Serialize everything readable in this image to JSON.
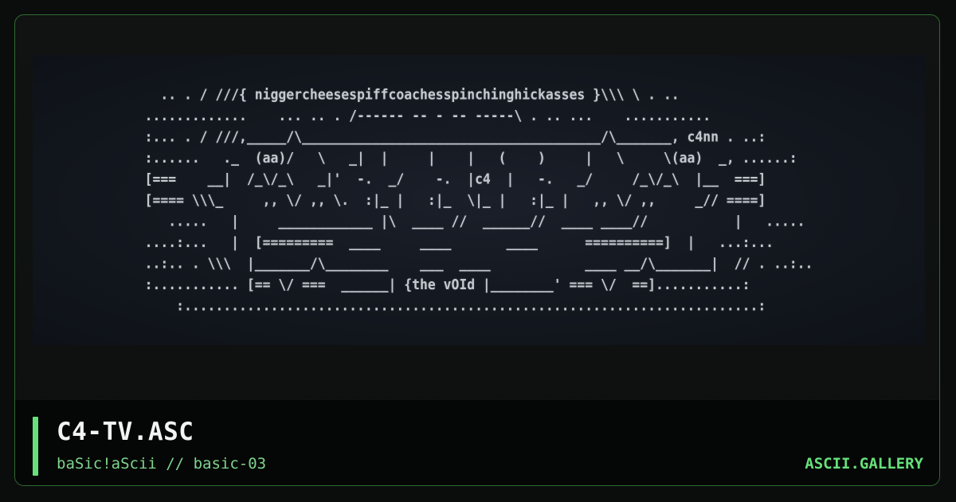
{
  "art": {
    "text": "  .. . / ///{ niggercheesespiffcoachesspinchinghickasses }\\\\\\ \\ . ..\n.............    ... .. . /------ -- - -- -----\\ . .. ...    ...........\n:... . / ///,_____/\\______________________________________/\\_______, c4nn . ..:\n:......   ._  (aa)/   \\   _|  |     |    |   (    )     |   \\     \\(aa)  _, ......:\n[===    __|  /_\\/_\\   _|'  -.  _/    -.  |c4  |   -.   _/     /_\\/_\\  |__  ===]\n[==== \\\\\\_     ,, \\/ ,, \\.  :|_ |   :|_  \\|_ |   :|_ |   ,, \\/ ,,     _// ====]\n   .....   |     ____________ |\\  ____ //  ______//  ____ ____//           |   .....\n....:...   |  [=========  ____     ____       ____      ==========]  |   ...:...\n..:.. . \\\\\\  |_______/\\________    ___  ____            ____ __/\\_______|  // . ..:..\n:........... [== \\/ ===  ______| {the vOId |________' === \\/  ==]...........:\n    :.........................................................................:"
  },
  "footer": {
    "title": "C4-TV.ASC",
    "subtitle": "baSic!aScii // basic-03",
    "brand": "ASCII.GALLERY"
  },
  "colors": {
    "accent": "#66e07a",
    "border": "#2f6b2f",
    "background": "#0b0d0d",
    "art_panel": "#151a22",
    "art_text": "#c4c9cf"
  }
}
